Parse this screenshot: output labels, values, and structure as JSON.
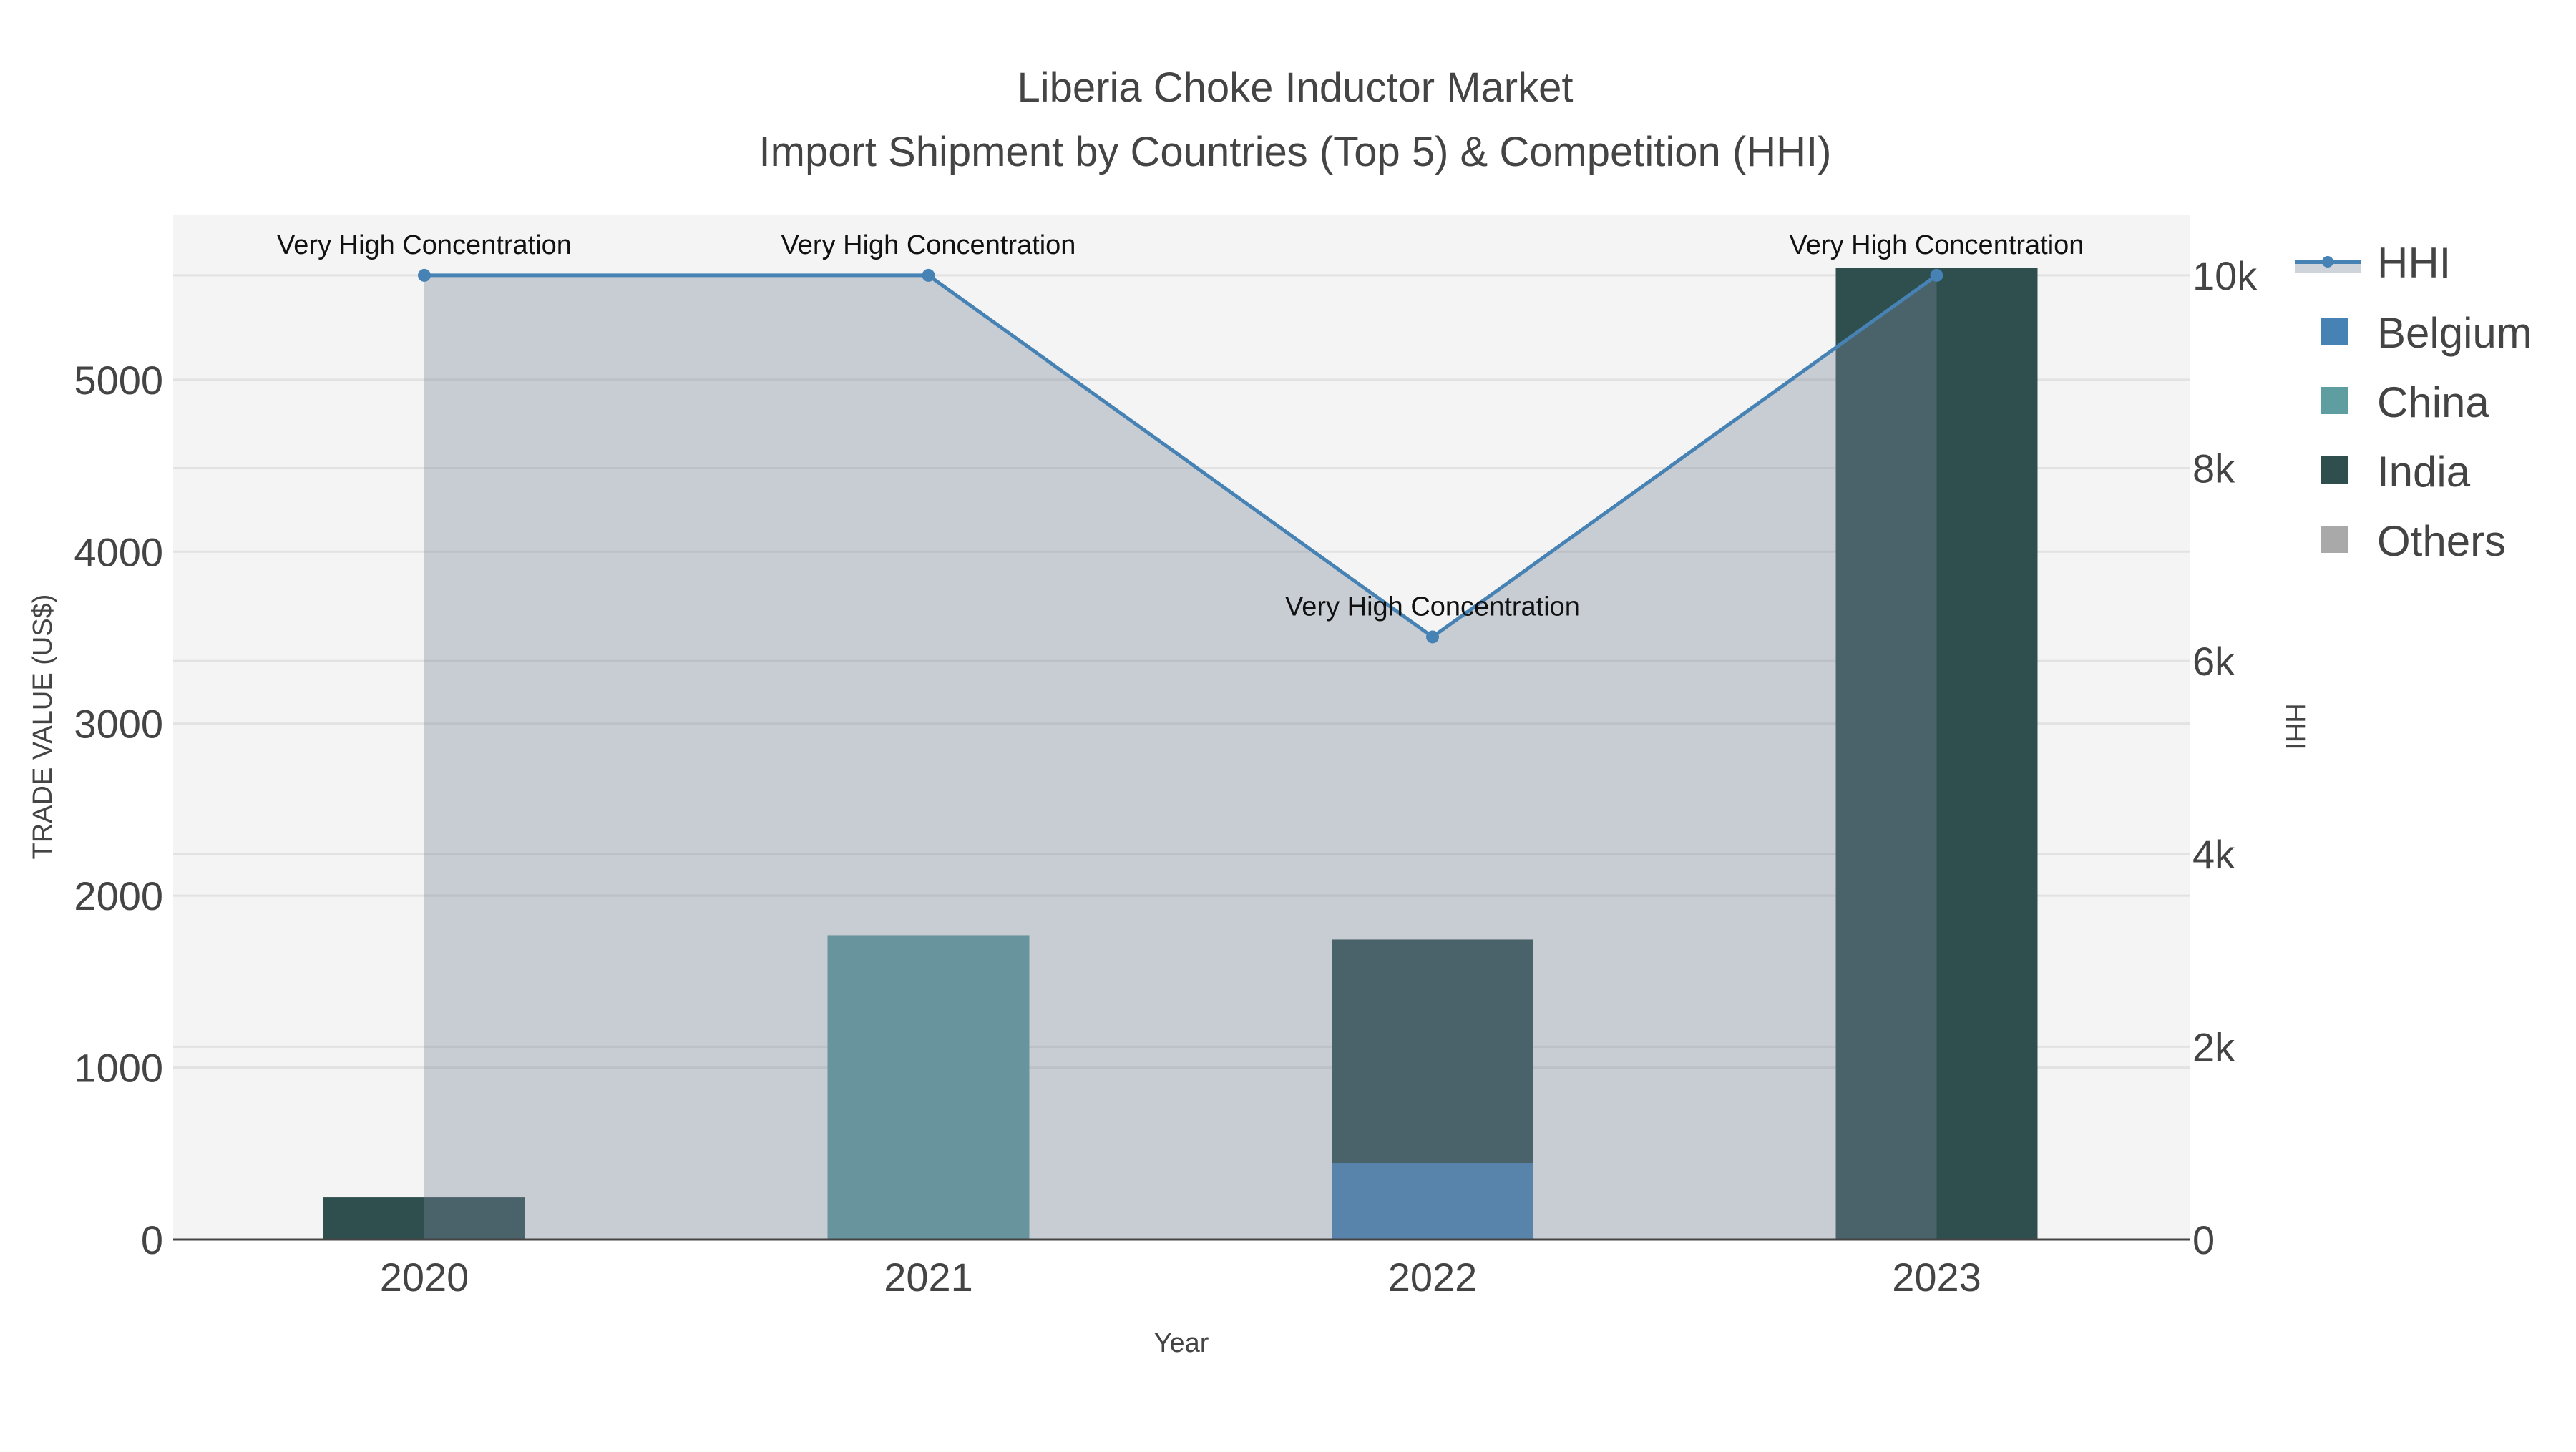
{
  "chart_data": {
    "type": "bar",
    "title": "Liberia Choke Inductor Market",
    "subtitle": "Import Shipment by Countries (Top 5) & Competition (HHI)",
    "xlabel": "Year",
    "ylabel": "TRADE VALUE (US$)",
    "y2label": "HHI",
    "categories": [
      "2020",
      "2021",
      "2022",
      "2023"
    ],
    "ylim": [
      0,
      5960
    ],
    "y2lim": [
      0,
      10630
    ],
    "yticks": [
      0,
      1000,
      2000,
      3000,
      4000,
      5000
    ],
    "ytick_labels": [
      "0",
      "1000",
      "2000",
      "3000",
      "4000",
      "5000"
    ],
    "y2ticks": [
      0,
      2000,
      4000,
      6000,
      8000,
      10000
    ],
    "y2tick_labels": [
      "0",
      "2k",
      "4k",
      "6k",
      "8k",
      "10k"
    ],
    "series": [
      {
        "name": "Belgium",
        "color": "#4682b4",
        "values": [
          0,
          0,
          445,
          0
        ]
      },
      {
        "name": "China",
        "color": "#5f9ea0",
        "values": [
          0,
          1770,
          0,
          0
        ]
      },
      {
        "name": "India",
        "color": "#2f4f4f",
        "values": [
          245,
          0,
          1300,
          5650
        ]
      },
      {
        "name": "Others",
        "color": "#a9a9a9",
        "values": [
          0,
          0,
          0,
          0
        ]
      }
    ],
    "hhi": {
      "name": "HHI",
      "color": "#4682b4",
      "values": [
        10000,
        10000,
        6250,
        10000
      ],
      "annotations": [
        "Very High Concentration",
        "Very High Concentration",
        "Very High Concentration",
        "Very High Concentration"
      ]
    },
    "legend_position": "top-right",
    "grid": true
  }
}
